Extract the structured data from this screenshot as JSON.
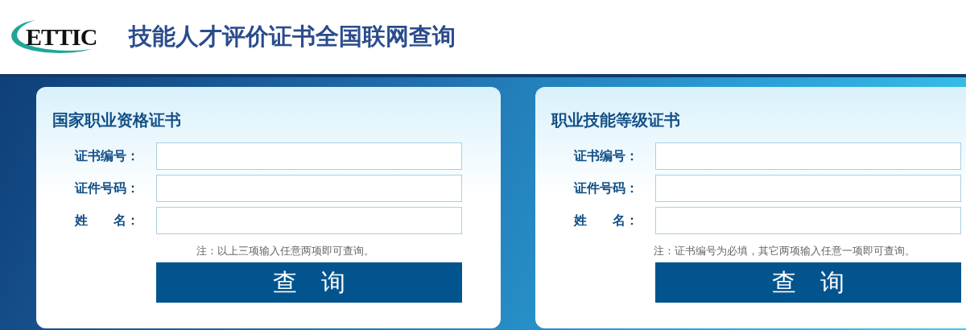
{
  "header": {
    "logo_text": "ETTIC",
    "title": "技能人才评价证书全国联网查询"
  },
  "cards": [
    {
      "title": "国家职业资格证书",
      "fields": [
        {
          "label": "证书编号："
        },
        {
          "label": "证件号码："
        },
        {
          "label": "姓　　名："
        }
      ],
      "note": "注：以上三项输入任意两项即可查询。",
      "button": "查　询"
    },
    {
      "title": "职业技能等级证书",
      "fields": [
        {
          "label": "证书编号："
        },
        {
          "label": "证件号码："
        },
        {
          "label": "姓　　名："
        }
      ],
      "note": "注：证书编号为必填，其它两项输入任意一项即可查询。",
      "button": "查　询"
    }
  ]
}
